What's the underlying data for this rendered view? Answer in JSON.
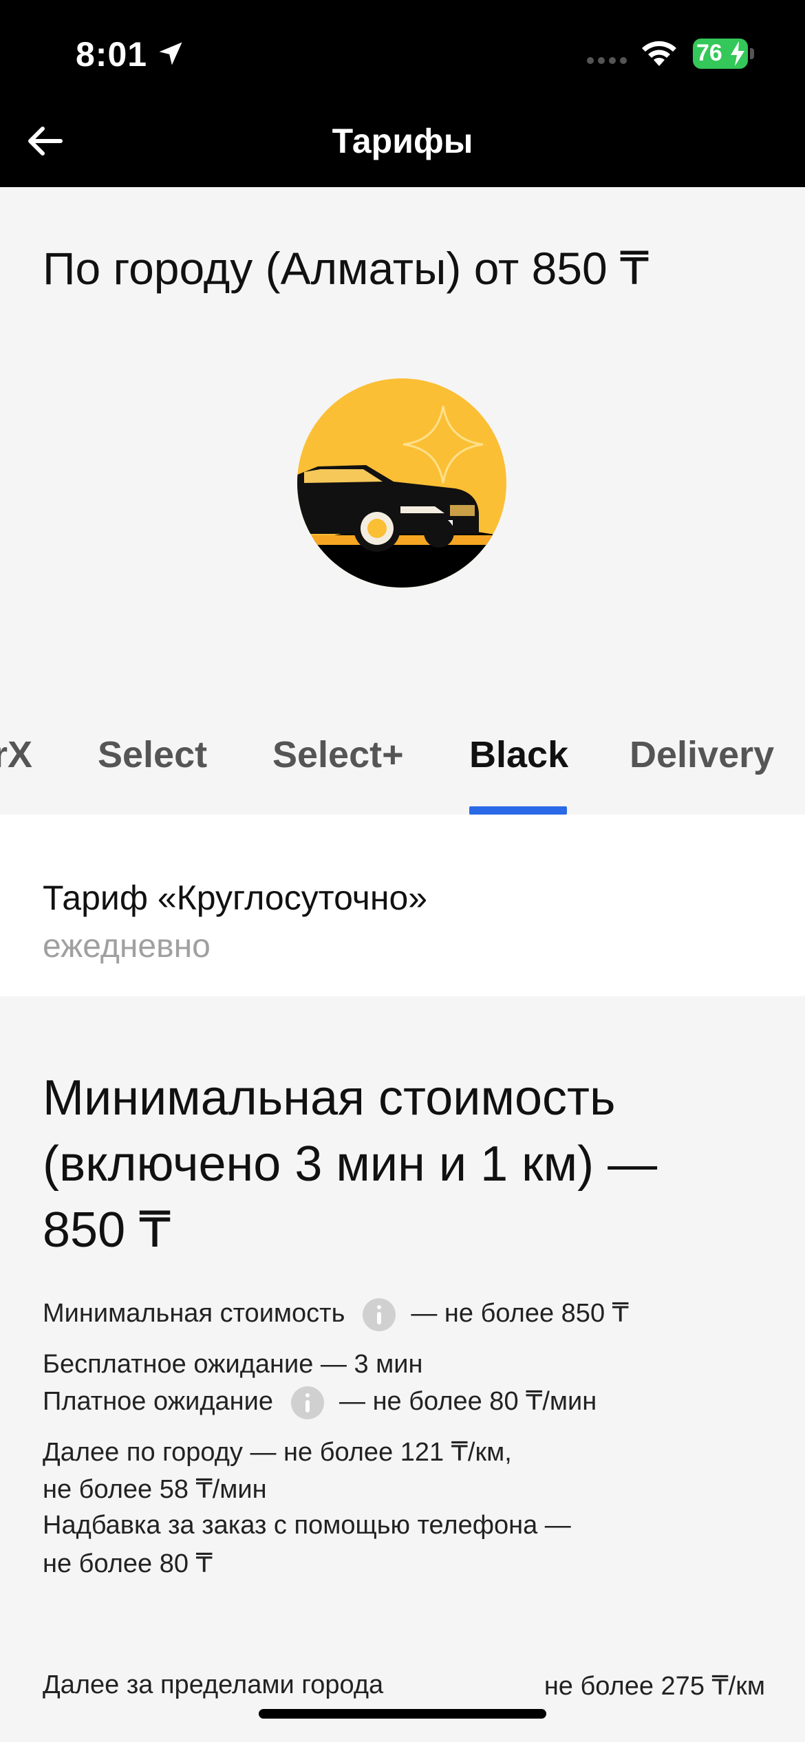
{
  "status_bar": {
    "time": "8:01",
    "battery": "76",
    "icons": [
      "location-arrow-icon",
      "signal-icon",
      "wifi-icon",
      "battery-icon",
      "charging-bolt-icon"
    ],
    "battery_color": "#34c759"
  },
  "nav": {
    "title": "Тарифы",
    "back_icon": "arrow-left-icon"
  },
  "header": {
    "city_title": "По городу (Алматы) от 850 ₸",
    "illustration": "black-car-illustration"
  },
  "tabs": {
    "items": [
      {
        "label": "rX"
      },
      {
        "label": "Select"
      },
      {
        "label": "Select+"
      },
      {
        "label": "Black"
      },
      {
        "label": "Delivery"
      }
    ],
    "active": "Black",
    "accent_color": "#2b6ae6"
  },
  "tariff": {
    "name": "Тариф «Круглосуточно»",
    "schedule": "ежедневно"
  },
  "details": {
    "min_cost_title": "Минимальная стоимость (включено 3 мин и 1 км) — 850 ₸",
    "min_cost_label": "Минимальная стоимость",
    "min_cost_value": "— не более 850 ₸",
    "free_wait": "Бесплатное ожидание — 3 мин",
    "paid_wait_label": "Платное ожидание",
    "paid_wait_value": "— не более 80 ₸/мин",
    "city_rate_line1": "Далее по городу — не более 121 ₸/км,",
    "city_rate_line2": "не более 58 ₸/мин",
    "phone_fee_line1": "Надбавка за заказ с помощью телефона —",
    "phone_fee_line2": "не более 80 ₸",
    "outside_label": "Далее за пределами города",
    "outside_value": "не более 275 ₸/км"
  }
}
